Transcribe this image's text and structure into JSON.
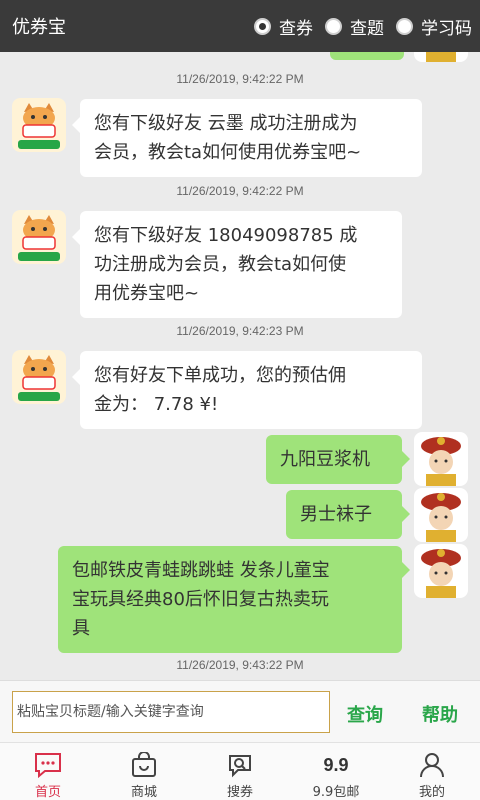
{
  "header": {
    "title": "优券宝",
    "options": [
      {
        "label": "查券",
        "checked": true
      },
      {
        "label": "查题",
        "checked": false
      },
      {
        "label": "学习码",
        "checked": false
      }
    ]
  },
  "messages": [
    {
      "timestamp": "11/26/2019, 9:42:22 PM",
      "direction": "in",
      "lines": [
        "您有下级好友 云墨 成功注册成为",
        "会员，教会ta如何使用优券宝吧~"
      ]
    },
    {
      "timestamp": "11/26/2019, 9:42:22 PM",
      "direction": "in",
      "lines": [
        "您有下级好友 18049098785 成",
        "功注册成为会员，教会ta如何使",
        "用优券宝吧~"
      ]
    },
    {
      "timestamp": "11/26/2019, 9:42:23 PM",
      "direction": "in",
      "lines": [
        "您有好友下单成功，您的预估佣",
        "金为：  7.78 ¥!"
      ]
    },
    {
      "direction": "out",
      "lines": [
        "九阳豆浆机"
      ]
    },
    {
      "direction": "out",
      "lines": [
        "男士袜子"
      ]
    },
    {
      "direction": "out",
      "lines": [
        "包邮铁皮青蛙跳跳蛙 发条儿童宝",
        "宝玩具经典80后怀旧复古热卖玩",
        "具"
      ]
    },
    {
      "timestamp": "11/26/2019, 9:43:22 PM"
    }
  ],
  "avatars": {
    "bot_badge": "券宝",
    "bot_caption": "官方正版"
  },
  "input": {
    "placeholder": "粘贴宝贝标题/输入关键字查询",
    "value": "",
    "query_label": "查询",
    "help_label": "帮助"
  },
  "nav": {
    "items": [
      {
        "label": "首页",
        "icon": "home-chat-icon",
        "active": true
      },
      {
        "label": "商城",
        "icon": "shopping-bag-icon",
        "active": false
      },
      {
        "label": "搜券",
        "icon": "search-chat-icon",
        "active": false
      },
      {
        "label": "9.9包邮",
        "icon": "nine-nine-icon",
        "icon_text": "9.9",
        "active": false
      },
      {
        "label": "我的",
        "icon": "user-icon",
        "active": false
      }
    ]
  },
  "colors": {
    "header_bg": "#3a3a3a",
    "bubble_out": "#9fe37a",
    "accent_green": "#2aa64a",
    "nav_active": "#d9304a"
  }
}
